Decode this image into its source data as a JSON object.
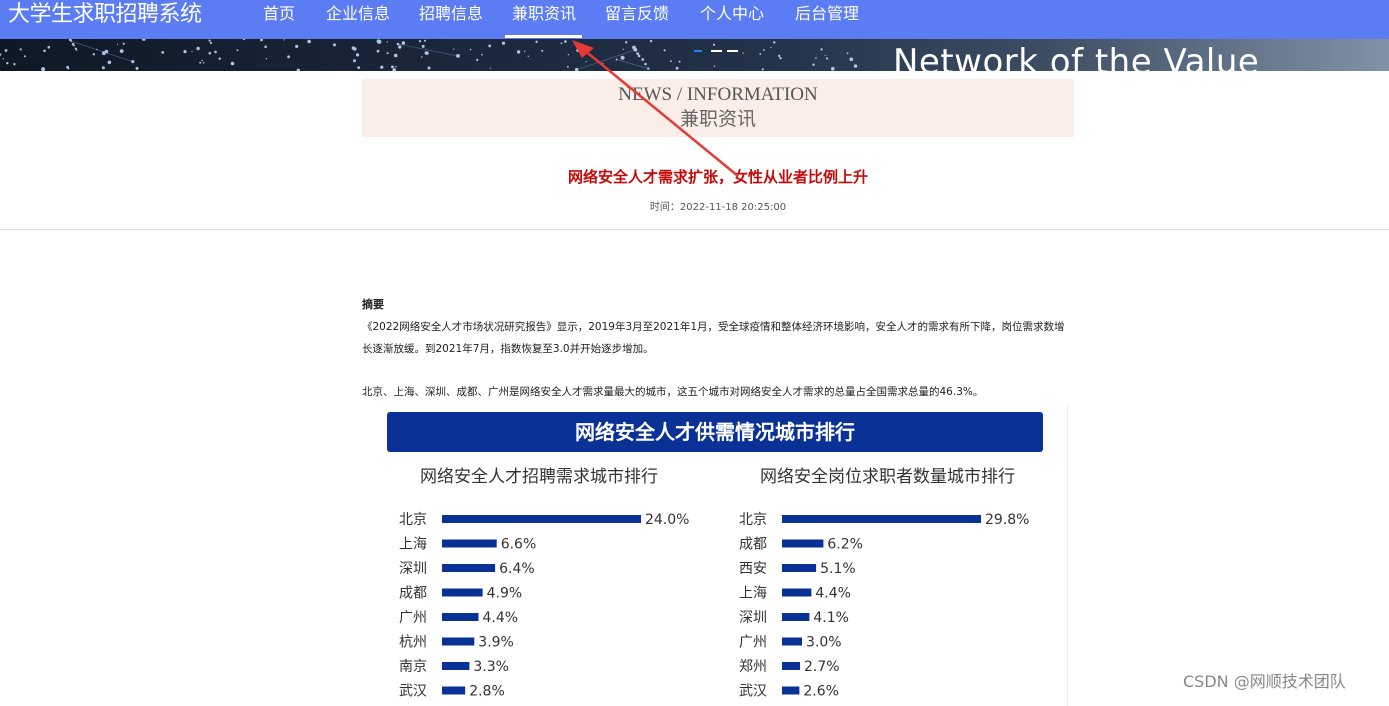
{
  "nav": {
    "brand": "大学生求职招聘系统",
    "items": [
      "首页",
      "企业信息",
      "招聘信息",
      "兼职资讯",
      "留言反馈",
      "个人中心",
      "后台管理"
    ],
    "active": "兼职资讯"
  },
  "banner": {
    "text": "Network of the Value"
  },
  "section": {
    "title_en": "NEWS / INFORMATION",
    "title_cn": "兼职资讯"
  },
  "article": {
    "title": "网络安全人才需求扩张，女性从业者比例上升",
    "time": "时间：2022-11-18 20:25:00",
    "abstract_label": "摘要",
    "paragraph_1": "《2022网络安全人才市场状况研究报告》显示，2019年3月至2021年1月，受全球疫情和整体经济环境影响，安全人才的需求有所下降，岗位需求数增长逐渐放缓。到2021年7月，指数恢复至3.0并开始逐步增加。",
    "paragraph_2": "北京、上海、深圳、成都、广州是网络安全人才需求量最大的城市，这五个城市对网络安全人才需求的总量占全国需求总量的46.3%。"
  },
  "infographic": {
    "banner": "网络安全人才供需情况城市排行"
  },
  "chart_data": [
    {
      "type": "bar",
      "title": "网络安全人才招聘需求城市排行",
      "categories": [
        "北京",
        "上海",
        "深圳",
        "成都",
        "广州",
        "杭州",
        "南京",
        "武汉"
      ],
      "values": [
        24.0,
        6.6,
        6.4,
        4.9,
        4.4,
        3.9,
        3.3,
        2.8
      ],
      "value_labels": [
        "24.0%",
        "6.6%",
        "6.4%",
        "4.9%",
        "4.4%",
        "3.9%",
        "3.3%",
        "2.8%"
      ],
      "bar_color": "#0a3195"
    },
    {
      "type": "bar",
      "title": "网络安全岗位求职者数量城市排行",
      "categories": [
        "北京",
        "成都",
        "西安",
        "上海",
        "深圳",
        "广州",
        "郑州",
        "武汉"
      ],
      "values": [
        29.8,
        6.2,
        5.1,
        4.4,
        4.1,
        3.0,
        2.7,
        2.6
      ],
      "value_labels": [
        "29.8%",
        "6.2%",
        "5.1%",
        "4.4%",
        "4.1%",
        "3.0%",
        "2.7%",
        "2.6%"
      ],
      "bar_color": "#0a3195"
    }
  ],
  "watermark": "CSDN @网顺技术团队",
  "colors": {
    "nav": "#5b7cf2",
    "title_red": "#c60a0a",
    "section_bg": "#fbeee8",
    "annotation_arrow": "#e53935"
  }
}
